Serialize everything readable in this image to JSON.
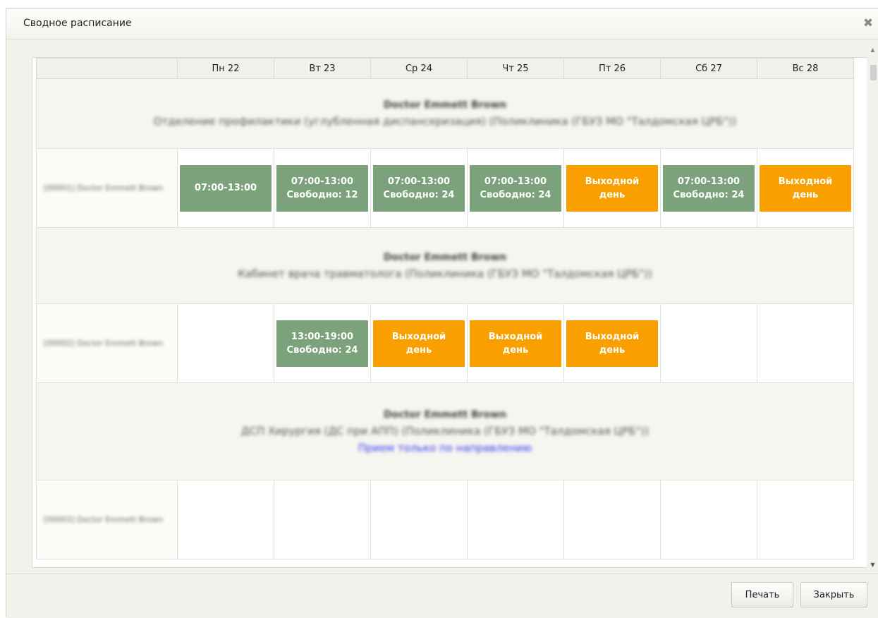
{
  "dialog": {
    "title": "Сводное расписание",
    "close_icon": "close-icon"
  },
  "days": [
    "Пн 22",
    "Вт 23",
    "Ср 24",
    "Чт 25",
    "Пт 26",
    "Сб 27",
    "Вс 28"
  ],
  "groups": [
    {
      "doctor": "Doctor Emmett Brown",
      "department": "Отделение профилактики (углубленная диспансеризация) (Поликлиника (ГБУЗ МО \"Талдомская ЦРБ\"))",
      "slot_label": "[00001] Doctor Emmett Brown",
      "cells": [
        {
          "type": "green",
          "line1": "07:00-13:00",
          "line2": ""
        },
        {
          "type": "green",
          "line1": "07:00-13:00",
          "line2": "Свободно: 12"
        },
        {
          "type": "green",
          "line1": "07:00-13:00",
          "line2": "Свободно: 24"
        },
        {
          "type": "green",
          "line1": "07:00-13:00",
          "line2": "Свободно: 24"
        },
        {
          "type": "orange",
          "line1": "Выходной",
          "line2": "день"
        },
        {
          "type": "green",
          "line1": "07:00-13:00",
          "line2": "Свободно: 24"
        },
        {
          "type": "orange",
          "line1": "Выходной",
          "line2": "день"
        }
      ]
    },
    {
      "doctor": "Doctor Emmett Brown",
      "department": "Кабинет врача травматолога (Поликлиника (ГБУЗ МО \"Талдомская ЦРБ\"))",
      "slot_label": "[00002] Doctor Emmett Brown",
      "cells": [
        {
          "type": "empty"
        },
        {
          "type": "green",
          "line1": "13:00-19:00",
          "line2": "Свободно: 24"
        },
        {
          "type": "orange",
          "line1": "Выходной",
          "line2": "день"
        },
        {
          "type": "orange",
          "line1": "Выходной",
          "line2": "день"
        },
        {
          "type": "orange",
          "line1": "Выходной",
          "line2": "день"
        },
        {
          "type": "empty"
        },
        {
          "type": "empty"
        }
      ]
    },
    {
      "doctor": "Doctor Emmett Brown",
      "department": "ДСП Хирургия (ДС при АПП) (Поликлиника (ГБУЗ МО \"Талдомская ЦРБ\"))",
      "note": "Прием только по направлению",
      "slot_label": "[00003] Doctor Emmett Brown",
      "cells": [
        {
          "type": "empty"
        },
        {
          "type": "empty"
        },
        {
          "type": "empty"
        },
        {
          "type": "empty"
        },
        {
          "type": "empty"
        },
        {
          "type": "empty"
        },
        {
          "type": "empty"
        }
      ]
    }
  ],
  "footer": {
    "print_label": "Печать",
    "close_label": "Закрыть"
  },
  "colors": {
    "free": "#7ba27b",
    "day_off": "#f9a000"
  }
}
